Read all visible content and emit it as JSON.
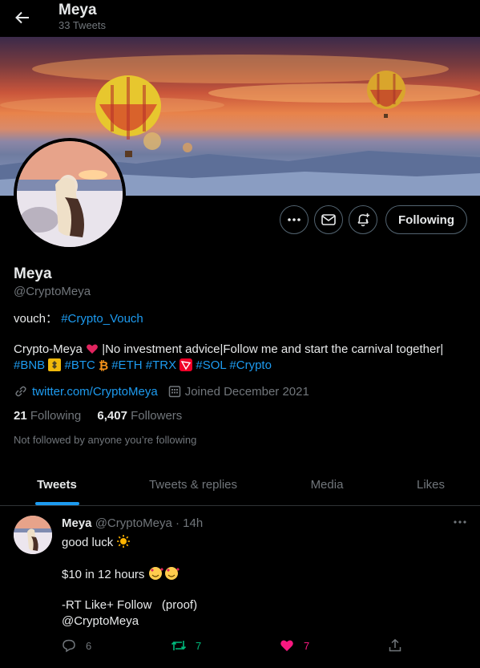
{
  "header": {
    "title": "Meya",
    "subtitle": "33 Tweets"
  },
  "profile": {
    "name": "Meya",
    "handle": "@CryptoMeya",
    "vouch_label": "vouch：",
    "vouch_link": "#Crypto_Vouch",
    "bio_line1": "Crypto-Meya",
    "bio_line1_rest": "|No investment advice|Follow me and start the carnival together|",
    "hashtags": {
      "bnb": "#BNB",
      "btc": "#BTC",
      "eth": "#ETH",
      "trx": "#TRX",
      "sol": "#SOL",
      "crypto": "#Crypto"
    },
    "website": "twitter.com/CryptoMeya",
    "joined": "Joined December 2021",
    "following_count": "21",
    "following_label": "Following",
    "followers_count": "6,407",
    "followers_label": "Followers",
    "not_followed": "Not followed by anyone you’re following",
    "following_button": "Following"
  },
  "tabs": [
    "Tweets",
    "Tweets & replies",
    "Media",
    "Likes"
  ],
  "tweet": {
    "name": "Meya",
    "handle": "@CryptoMeya",
    "time": "· 14h",
    "line1": "good luck",
    "line2": "$10 in 12 hours",
    "line3": "-RT Like+ Follow   (proof)",
    "mention": "@CryptoMeya",
    "replies": "6",
    "retweets": "7",
    "likes": "7"
  },
  "colors": {
    "accent": "#1d9bf0",
    "retweet": "#00ba7c",
    "like": "#f91880",
    "muted": "#71767b"
  },
  "icons": [
    "back-arrow-icon",
    "more-icon",
    "mail-icon",
    "bell-plus-icon",
    "link-icon",
    "calendar-icon",
    "reply-icon",
    "retweet-icon",
    "heart-icon",
    "share-icon"
  ]
}
